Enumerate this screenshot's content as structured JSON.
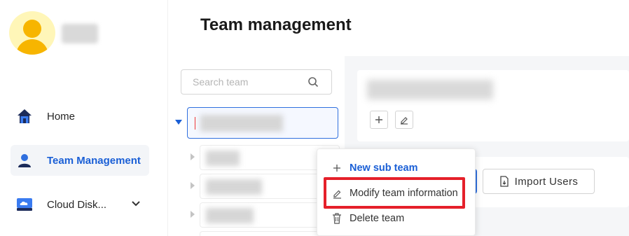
{
  "page": {
    "title": "Team management"
  },
  "sidebar": {
    "items": [
      {
        "label": "Home",
        "icon": "home-icon"
      },
      {
        "label": "Team Management",
        "icon": "team-user-icon",
        "active": true
      },
      {
        "label": "Cloud Disk...",
        "icon": "cloud-disk-icon"
      }
    ]
  },
  "search": {
    "placeholder": "Search team"
  },
  "actions": {
    "import_label": "Import Users"
  },
  "context_menu": {
    "items": [
      {
        "label": "New sub team",
        "icon": "plus-icon"
      },
      {
        "label": "Modify team information",
        "icon": "edit-icon"
      },
      {
        "label": "Delete team",
        "icon": "trash-icon"
      }
    ]
  },
  "colors": {
    "accent": "#1a5fd6",
    "highlight": "#e5202a",
    "avatar": "#f7b500"
  }
}
